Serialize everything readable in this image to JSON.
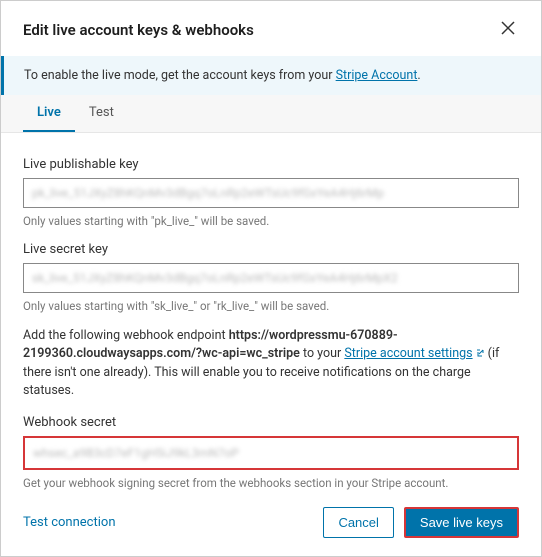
{
  "title": "Edit live account keys & webhooks",
  "banner": {
    "text_before": "To enable the live mode, get the account keys from your ",
    "link_text": "Stripe Account",
    "text_after": "."
  },
  "tabs": {
    "live": "Live",
    "test": "Test"
  },
  "fields": {
    "publishable": {
      "label": "Live publishable key",
      "value": "pk_live_51JXyZ8hKQnMv3dBgq7oLnRp2eWTsUc9fGxYeA4Hj6rMp",
      "hint": "Only values starting with \"pk_live_\" will be saved."
    },
    "secret": {
      "label": "Live secret key",
      "value": "sk_live_51JXyZ8hKQnMv3dBgq7oLnRp2eWTsUc9fGxYeA4Hj6rMpX2",
      "hint": "Only values starting with \"sk_live_\" or \"rk_live_\" will be saved."
    },
    "webhook": {
      "label": "Webhook secret",
      "value": "whsec_a9B3cD7eF1gH5iJ9kL3mN7oP",
      "hint": "Get your webhook signing secret from the webhooks section in your Stripe account."
    }
  },
  "webhook_instructions": {
    "prefix": "Add the following webhook endpoint ",
    "url": "https://wordpressmu-670889-2199360.cloudwaysapps.com/?wc-api=wc_stripe",
    "mid": " to your ",
    "link_text": "Stripe account settings",
    "suffix": " (if there isn't one already). This will enable you to receive notifications on the charge statuses."
  },
  "footer": {
    "test_connection": "Test connection",
    "cancel": "Cancel",
    "save": "Save live keys"
  }
}
